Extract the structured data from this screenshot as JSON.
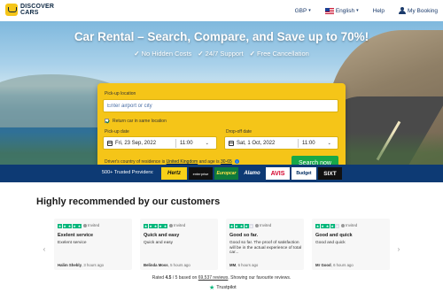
{
  "header": {
    "logo_line1": "DISCOVER",
    "logo_line2": "CARS",
    "currency": "GBP",
    "language": "English",
    "help": "Help",
    "booking": "My Booking"
  },
  "hero": {
    "title": "Car Rental – Search, Compare, and Save up to 70%!",
    "benefits": [
      "No Hidden Costs",
      "24/7 Support",
      "Free Cancellation"
    ]
  },
  "search": {
    "pickup_location_label": "Pick-up location",
    "pickup_location_placeholder": "Enter airport or city",
    "return_same_label": "Return car in same location",
    "pickup_date_label": "Pick-up date",
    "pickup_date": "Fri, 23 Sep, 2022",
    "pickup_time": "11:00",
    "dropoff_date_label": "Drop-off date",
    "dropoff_date": "Sat, 1 Oct, 2022",
    "dropoff_time": "11:00",
    "residence_prefix": "Driver's country of residence is",
    "residence_country": "United Kingdom",
    "residence_mid": "and age is",
    "residence_age": "30-65",
    "button": "Search now"
  },
  "providers": {
    "label": "500+ Trusted Providers:",
    "brands": [
      "Hertz",
      "enterprise",
      "Europcar",
      "Alamo",
      "AVIS",
      "Budget",
      "SIXT"
    ]
  },
  "reviews": {
    "title": "Highly recommended by our customers",
    "cards": [
      {
        "stars": 5,
        "invited": "Invited",
        "title": "Exelent service",
        "body": "Exelent service",
        "author": "Halim Shebly",
        "ago": "3 hours ago"
      },
      {
        "stars": 5,
        "invited": "Invited",
        "title": "Quick and easy",
        "body": "Quick and easy",
        "author": "Belinda Moss",
        "ago": "5 hours ago"
      },
      {
        "stars": 4,
        "invited": "Invited",
        "title": "Good so far.",
        "body": "Good so far. The proof of satisfaction will be in the actual experience of total car...",
        "author": "MM",
        "ago": "6 hours ago"
      },
      {
        "stars": 4,
        "invited": "Invited",
        "title": "Good and quick",
        "body": "Good and quick",
        "author": "Mr Good",
        "ago": "6 hours ago"
      }
    ],
    "rated_prefix": "Rated",
    "rating": "4.5",
    "rated_mid": "/ 5 based on",
    "review_count": "69,537 reviews",
    "rated_suffix": ". Showing our favourite reviews.",
    "trustpilot": "Trustpilot"
  },
  "colors": {
    "accent_yellow": "#f5c518",
    "button_green": "#18a848",
    "navy": "#0d3a74",
    "trustpilot_green": "#00b67a"
  }
}
